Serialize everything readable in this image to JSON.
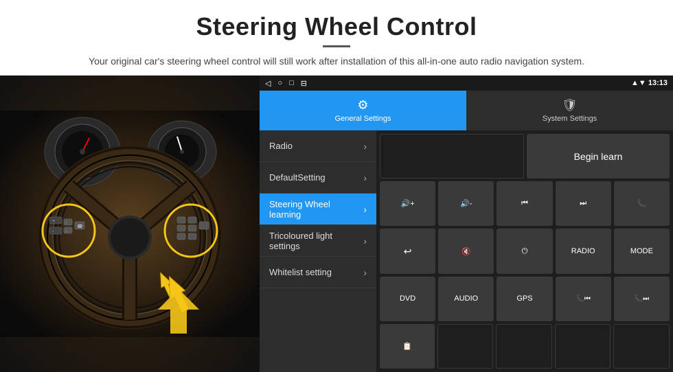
{
  "header": {
    "title": "Steering Wheel Control",
    "subtitle": "Your original car's steering wheel control will still work after installation of this all-in-one auto radio navigation system."
  },
  "status_bar": {
    "nav_back": "◁",
    "nav_home": "○",
    "nav_recent": "□",
    "nav_cast": "⊟",
    "time": "13:13",
    "signal_icon": "▲",
    "wifi_icon": "▼"
  },
  "tabs": [
    {
      "id": "general",
      "label": "General Settings",
      "icon": "⚙",
      "active": true
    },
    {
      "id": "system",
      "label": "System Settings",
      "icon": "🛡",
      "active": false
    }
  ],
  "menu": {
    "items": [
      {
        "id": "radio",
        "label": "Radio",
        "active": false
      },
      {
        "id": "default",
        "label": "DefaultSetting",
        "active": false
      },
      {
        "id": "steering",
        "label": "Steering Wheel learning",
        "active": true
      },
      {
        "id": "tricoloured",
        "label": "Tricoloured light settings",
        "active": false
      },
      {
        "id": "whitelist",
        "label": "Whitelist setting",
        "active": false
      }
    ]
  },
  "grid": {
    "begin_learn": "Begin learn",
    "buttons": [
      [
        "vol+",
        "vol-",
        "prev-track",
        "next-track",
        "phone"
      ],
      [
        "hang-up",
        "mute",
        "power",
        "radio-btn",
        "mode"
      ],
      [
        "dvd",
        "audio",
        "gps",
        "prev-combo",
        "next-combo"
      ],
      [
        "media"
      ]
    ],
    "labels": {
      "vol_up": "🔊+",
      "vol_down": "🔊-",
      "prev": "⏮",
      "next": "⏭",
      "phone": "📞",
      "hang_up": "↩",
      "mute": "🔇",
      "power": "⏻",
      "radio": "RADIO",
      "mode": "MODE",
      "dvd": "DVD",
      "audio": "AUDIO",
      "gps": "GPS",
      "prev_combo": "📞⏮",
      "next_combo": "📞⏭",
      "media": "📋"
    }
  }
}
